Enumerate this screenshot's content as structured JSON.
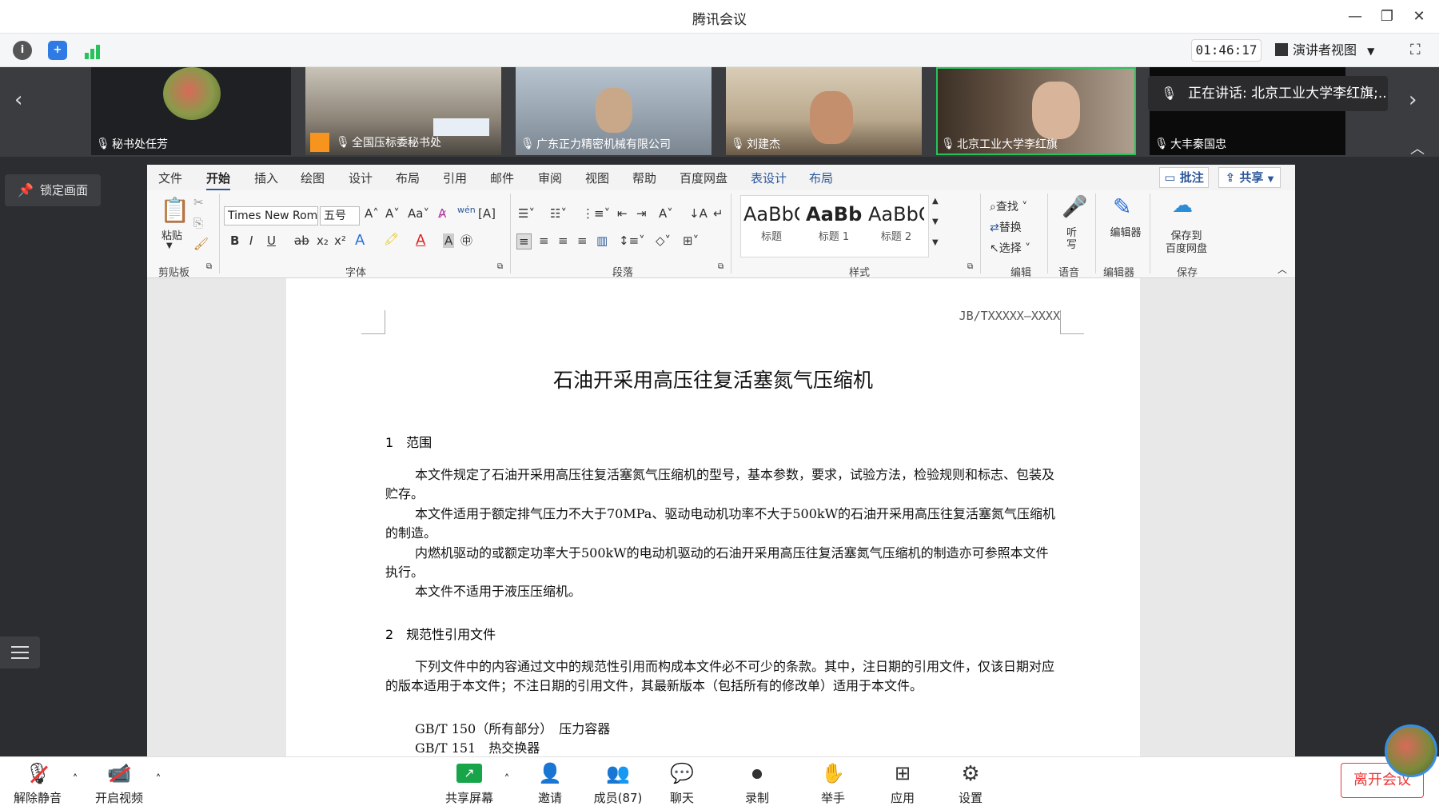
{
  "app": {
    "title": "腾讯会议"
  },
  "toolbar": {
    "timer": "01:46:17",
    "view_label": "演讲者视图"
  },
  "participants": [
    {
      "name": "秘书处任芳",
      "muted": true
    },
    {
      "name": "全国压标委秘书处",
      "muted": false
    },
    {
      "name": "广东正力精密机械有限公司",
      "muted": true
    },
    {
      "name": "刘建杰",
      "muted": true
    },
    {
      "name": "北京工业大学李红旗",
      "muted": false
    },
    {
      "name": "大丰秦国忠",
      "muted": true
    }
  ],
  "speaking": {
    "text": "正在讲话: 北京工业大学李红旗;..."
  },
  "side": {
    "lock_label": "锁定画面"
  },
  "word": {
    "tabs": [
      "文件",
      "开始",
      "插入",
      "绘图",
      "设计",
      "布局",
      "引用",
      "邮件",
      "审阅",
      "视图",
      "帮助",
      "百度网盘",
      "表设计",
      "布局"
    ],
    "comment_label": "批注",
    "share_label": "共享",
    "font_name": "Times New Roman",
    "font_size": "五号",
    "paste_label": "粘贴",
    "groups": {
      "clipboard": "剪贴板",
      "font": "字体",
      "paragraph": "段落",
      "styles": "样式",
      "editing": "编辑",
      "voice": "语音",
      "editor": "编辑器",
      "save": "保存"
    },
    "styles": [
      {
        "preview": "AaBbC",
        "name": "标题"
      },
      {
        "preview": "AaBb",
        "name": "标题 1"
      },
      {
        "preview": "AaBbC",
        "name": "标题 2"
      }
    ],
    "find_label": "查找",
    "replace_label": "替换",
    "select_label": "选择",
    "dictate_label": "听写",
    "editor_label": "编辑器",
    "save_baidu_label1": "保存到",
    "save_baidu_label2": "百度网盘"
  },
  "doc": {
    "code": "JB/TXXXXX—XXXX",
    "title": "石油开采用高压往复活塞氮气压缩机",
    "s1_heading": "1　范围",
    "p1": "本文件规定了石油开采用高压往复活塞氮气压缩机的型号，基本参数，要求，试验方法，检验规则和标志、包装及贮存。",
    "p2": "本文件适用于额定排气压力不大于70MPa、驱动电动机功率不大于500kW的石油开采用高压往复活塞氮气压缩机的制造。",
    "p3": "内燃机驱动的或额定功率大于500kW的电动机驱动的石油开采用高压往复活塞氮气压缩机的制造亦可参照本文件执行。",
    "p4": "本文件不适用于液压压缩机。",
    "s2_heading": "2　规范性引用文件",
    "p5": "下列文件中的内容通过文中的规范性引用而构成本文件必不可少的条款。其中，注日期的引用文件，仅该日期对应的版本适用于本文件；不注日期的引用文件，其最新版本（包括所有的修改单）适用于本文件。",
    "ref1": "GB/T 150（所有部分）　压力容器",
    "ref2": "GB/T 151　热交换器"
  },
  "bottom": {
    "unmute": "解除静音",
    "video": "开启视频",
    "share": "共享屏幕",
    "invite": "邀请",
    "members": "成员(87)",
    "chat": "聊天",
    "record": "录制",
    "raise": "举手",
    "apps": "应用",
    "settings": "设置",
    "leave": "离开会议"
  },
  "colors": {
    "accent": "#2b579a",
    "active_speaker": "#27c35a",
    "leave": "#e33333"
  }
}
